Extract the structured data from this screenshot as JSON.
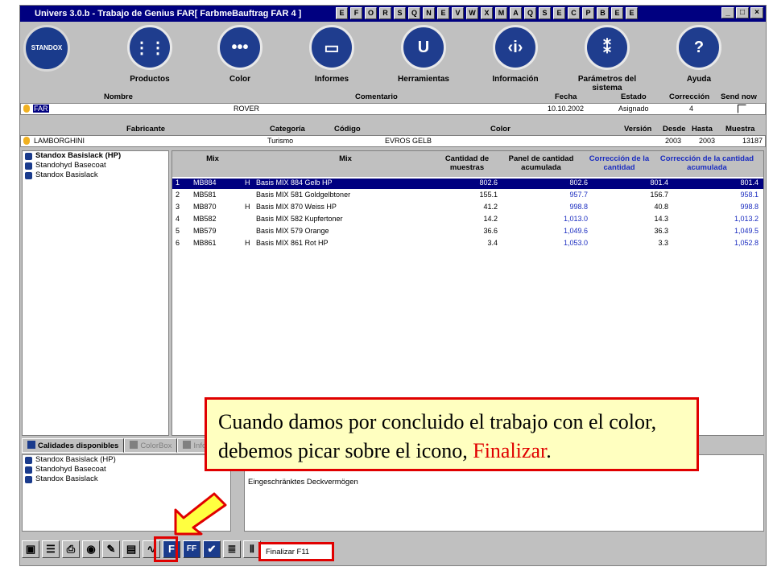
{
  "window": {
    "title": "Univers 3.0.b - Trabajo de Genius FAR[ FarbmeBauftrag FAR 4 ]"
  },
  "titlebar_icons": [
    "E",
    "F",
    "O",
    "R",
    "S",
    "Q",
    "N",
    "E",
    "V",
    "W",
    "X",
    "M",
    "A",
    "Q",
    "S",
    "E",
    "C",
    "P",
    "B",
    "E",
    "E"
  ],
  "window_buttons": [
    "_",
    "□",
    "×"
  ],
  "logo": {
    "text": "STANDOX"
  },
  "nav": [
    {
      "label": "Productos",
      "icon": "palette-icon",
      "glyph": "⋮⋮"
    },
    {
      "label": "Color",
      "icon": "color-dots-icon",
      "glyph": "•••"
    },
    {
      "label": "Informes",
      "icon": "report-image-icon",
      "glyph": "▭"
    },
    {
      "label": "Herramientas",
      "icon": "tools-icon",
      "glyph": "U"
    },
    {
      "label": "Información",
      "icon": "info-icon",
      "glyph": "‹i›"
    },
    {
      "label": "Parámetros del sistema",
      "icon": "settings-icon",
      "glyph": "⁑"
    },
    {
      "label": "Ayuda",
      "icon": "help-icon",
      "glyph": "?"
    }
  ],
  "job_header": {
    "nombre": "Nombre",
    "comentario": "Comentario",
    "fecha": "Fecha",
    "estado": "Estado",
    "correccion": "Corrección",
    "send_now": "Send now"
  },
  "job_row": {
    "nombre": "FAR",
    "comentario": "ROVER",
    "fecha": "10.10.2002",
    "estado": "Asignado",
    "correccion": "4"
  },
  "color_header": {
    "fabricante": "Fabricante",
    "categoria": "Categoría",
    "codigo": "Código",
    "color": "Color",
    "version": "Versión",
    "desde": "Desde",
    "hasta": "Hasta",
    "muestra": "Muestra"
  },
  "color_row": {
    "fabricante": "LAMBORGHINI",
    "categoria": "Turismo",
    "codigo": "",
    "color": "EVROS GELB",
    "version": "",
    "desde": "2003",
    "hasta": "2003",
    "muestra": "13187"
  },
  "product_list": [
    "Standox Basislack (HP)",
    "Standohyd Basecoat",
    "Standox Basislack"
  ],
  "grid_header": {
    "mix_code": "Mix",
    "mix_name": "Mix",
    "cantidad": "Cantidad de muestras",
    "panel": "Panel de cantidad acumulada",
    "correccion": "Corrección de la cantidad",
    "correccion_acum": "Corrección de la cantidad acumulada"
  },
  "grid_rows": [
    {
      "n": "1",
      "code": "MB884",
      "h": "H",
      "name": "Basis MIX 884 Gelb HP",
      "cant": "802.6",
      "panel": "802.6",
      "corr": "801.4",
      "acum": "801.4"
    },
    {
      "n": "2",
      "code": "MB581",
      "h": "",
      "name": "Basis MIX 581 Goldgelbtoner",
      "cant": "155.1",
      "panel": "957.7",
      "corr": "156.7",
      "acum": "958.1"
    },
    {
      "n": "3",
      "code": "MB870",
      "h": "H",
      "name": "Basis MIX 870 Weiss HP",
      "cant": "41.2",
      "panel": "998.8",
      "corr": "40.8",
      "acum": "998.8"
    },
    {
      "n": "4",
      "code": "MB582",
      "h": "",
      "name": "Basis MIX 582 Kupfertoner",
      "cant": "14.2",
      "panel": "1,013.0",
      "corr": "14.3",
      "acum": "1,013.2"
    },
    {
      "n": "5",
      "code": "MB579",
      "h": "",
      "name": "Basis MIX 579 Orange",
      "cant": "36.6",
      "panel": "1,049.6",
      "corr": "36.3",
      "acum": "1,049.5"
    },
    {
      "n": "6",
      "code": "MB861",
      "h": "H",
      "name": "Basis MIX 861 Rot HP",
      "cant": "3.4",
      "panel": "1,053.0",
      "corr": "3.3",
      "acum": "1,052.8"
    }
  ],
  "tabs": [
    "Calidades disponibles",
    "ColorBox",
    "Info"
  ],
  "qualities": [
    "Standox Basislack (HP)",
    "Standohyd Basecoat",
    "Standox Basislack"
  ],
  "notes": [
    "Eingeschränktes Deckvermögen"
  ],
  "toolbar_tools": [
    "save-icon",
    "list-icon",
    "printer-icon",
    "eye-icon",
    "pen-icon",
    "grid-icon",
    "chart-icon",
    "finalize-icon",
    "ff-icon",
    "check-icon",
    "document-icon",
    "pause-icon"
  ],
  "toolbar_glyphs": [
    "▣",
    "☰",
    "⎙",
    "◉",
    "✎",
    "▤",
    "∿",
    "F",
    "FF",
    "✔",
    "≣",
    "Ⅱ"
  ],
  "status": {
    "text": "Finalizar   F11"
  },
  "callout": {
    "text_before": "Cuando damos por concluido el trabajo con el color, debemos picar sobre el icono, ",
    "highlight": "Finalizar",
    "text_after": "."
  },
  "colors": {
    "accent_red": "#e00000",
    "selection": "#000080",
    "callout_bg": "#ffffc0",
    "brand_blue": "#1a3b8c"
  }
}
